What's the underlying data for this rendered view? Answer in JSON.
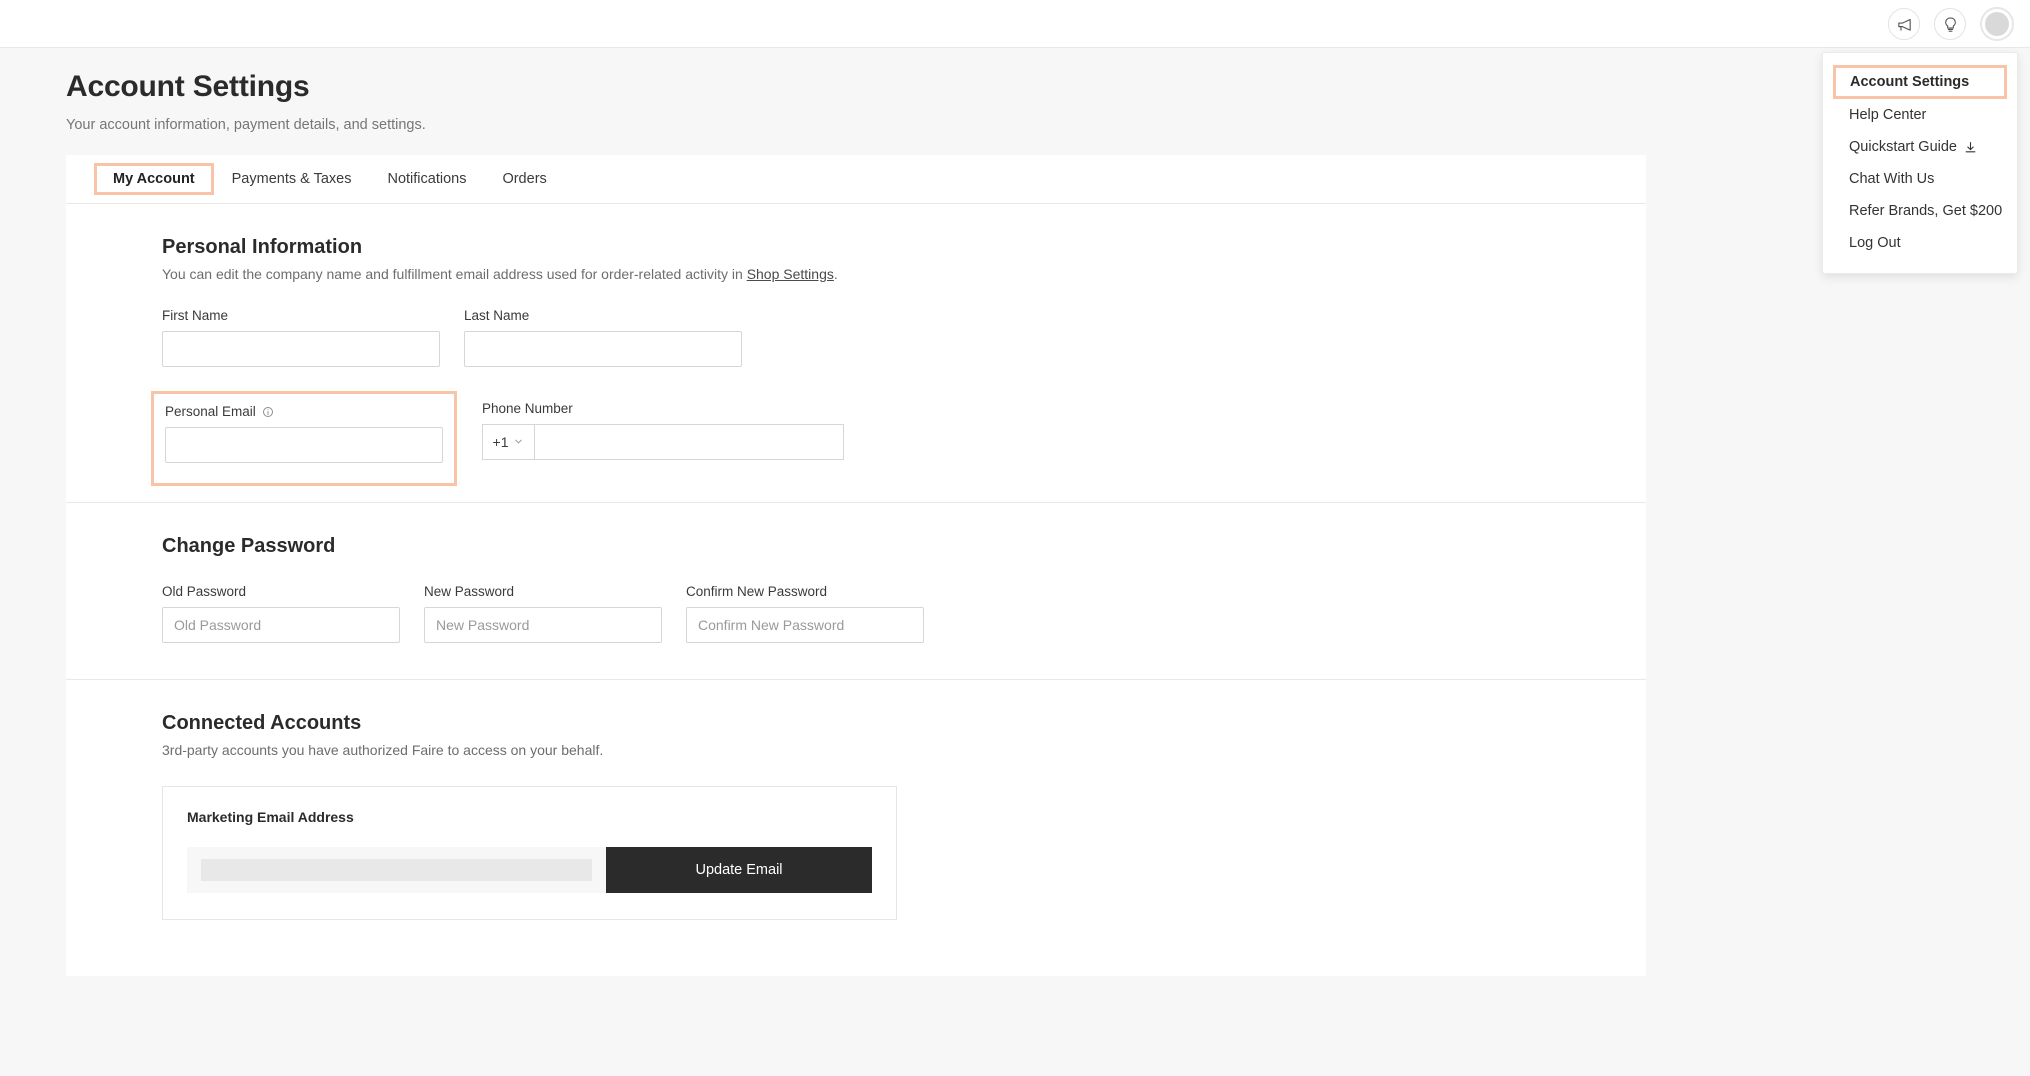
{
  "topbar": {
    "icons": [
      {
        "name": "megaphone-icon",
        "label": "Announcements"
      },
      {
        "name": "lightbulb-icon",
        "label": "Tips"
      },
      {
        "name": "avatar",
        "label": "Account menu"
      }
    ]
  },
  "dropdown": {
    "items": [
      {
        "label": "Account Settings",
        "highlighted": true,
        "icon": ""
      },
      {
        "label": "Help Center",
        "highlighted": false,
        "icon": ""
      },
      {
        "label": "Quickstart Guide",
        "highlighted": false,
        "icon": "download-icon"
      },
      {
        "label": "Chat With Us",
        "highlighted": false,
        "icon": ""
      },
      {
        "label": "Refer Brands, Get $200",
        "highlighted": false,
        "icon": ""
      },
      {
        "label": "Log Out",
        "highlighted": false,
        "icon": ""
      }
    ]
  },
  "page": {
    "title": "Account Settings",
    "subtitle": "Your account information, payment details, and settings."
  },
  "tabs": [
    {
      "label": "My Account",
      "active": true
    },
    {
      "label": "Payments & Taxes",
      "active": false
    },
    {
      "label": "Notifications",
      "active": false
    },
    {
      "label": "Orders",
      "active": false
    }
  ],
  "personal_information": {
    "title": "Personal Information",
    "description_before": "You can edit the company name and fulfillment email address used for order-related activity in ",
    "description_link": "Shop Settings",
    "description_after": ".",
    "first_name": {
      "label": "First Name",
      "value": "",
      "placeholder": ""
    },
    "last_name": {
      "label": "Last Name",
      "value": "",
      "placeholder": ""
    },
    "personal_email": {
      "label": "Personal Email",
      "value": "",
      "placeholder": "",
      "info_icon": "info-icon",
      "highlighted": true
    },
    "phone_number": {
      "label": "Phone Number",
      "country_code": "+1",
      "value": "",
      "placeholder": ""
    }
  },
  "change_password": {
    "title": "Change Password",
    "old_password": {
      "label": "Old Password",
      "value": "",
      "placeholder": "Old Password"
    },
    "new_password": {
      "label": "New Password",
      "value": "",
      "placeholder": "New Password"
    },
    "confirm_password": {
      "label": "Confirm New Password",
      "value": "",
      "placeholder": "Confirm New Password"
    }
  },
  "connected_accounts": {
    "title": "Connected Accounts",
    "description": "3rd-party accounts you have authorized Faire to access on your behalf.",
    "marketing_email": {
      "title": "Marketing Email Address",
      "value": "",
      "button_label": "Update Email"
    }
  },
  "colors": {
    "highlight": "#f9c3a8",
    "page_background": "#f7f7f7",
    "button_dark": "#2b2b2b",
    "text_primary": "#2b2b2b",
    "text_muted": "#767676"
  }
}
